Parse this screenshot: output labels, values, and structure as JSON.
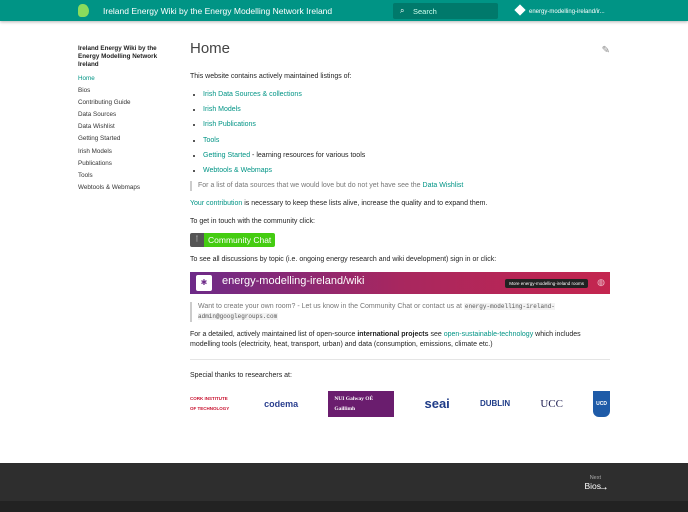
{
  "header": {
    "title": "Ireland Energy Wiki by the Energy Modelling Network Ireland",
    "search_placeholder": "Search",
    "repo": "energy-modelling-ireland/ir..."
  },
  "sidebar": {
    "title": "Ireland Energy Wiki by the Energy Modelling Network Ireland",
    "items": [
      "Home",
      "Bios",
      "Contributing Guide",
      "Data Sources",
      "Data Wishlist",
      "Getting Started",
      "Irish Models",
      "Publications",
      "Tools",
      "Webtools & Webmaps"
    ]
  },
  "main": {
    "title": "Home",
    "intro": "This website contains actively maintained listings of:",
    "list": [
      {
        "link": "Irish Data Sources & collections",
        "rest": ""
      },
      {
        "link": "Irish Models",
        "rest": ""
      },
      {
        "link": "Irish Publications",
        "rest": ""
      },
      {
        "link": "Tools",
        "rest": ""
      },
      {
        "link": "Getting Started",
        "rest": " - learning resources for various tools"
      },
      {
        "link": "Webtools & Webmaps",
        "rest": ""
      }
    ],
    "wishlist_text": "For a list of data sources that we would love but do not yet have see the ",
    "wishlist_link": "Data Wishlist",
    "contrib_link": "Your contribution",
    "contrib_text": " is necessary to keep these lists alive, increase the quality and to expand them.",
    "touch": "To get in touch with the community click:",
    "chat_badge": "Community Chat",
    "discussions": "To see all discussions by topic (i.e. ongoing energy research and wiki development) sign in or click:",
    "room": "energy-modelling-ireland/wiki",
    "more_rooms": "More energy-modelling-ireland rooms",
    "room_text": "Want to create your own room? - Let us know in the Community Chat or contact us at ",
    "room_email": "energy-modelling-ireland-admin@googlegroups.com",
    "projects_a": "For a detailed, actively maintained list of open-source ",
    "projects_b": "international projects",
    "projects_c": " see ",
    "projects_link": "open-sustainable-technology",
    "projects_d": " which includes modelling tools (electricity, heat, transport, urban) and data (consumption, emissions, climate etc.)",
    "thanks": "Special thanks to researchers at:",
    "logos": [
      "CORK INSTITUTE OF TECHNOLOGY",
      "codema",
      "NUI Galway OÉ Gaillimh",
      "seai",
      "DUBLIN",
      "UCC",
      "UCD"
    ]
  },
  "footer": {
    "next_label": "Next",
    "next_page": "Bios"
  }
}
